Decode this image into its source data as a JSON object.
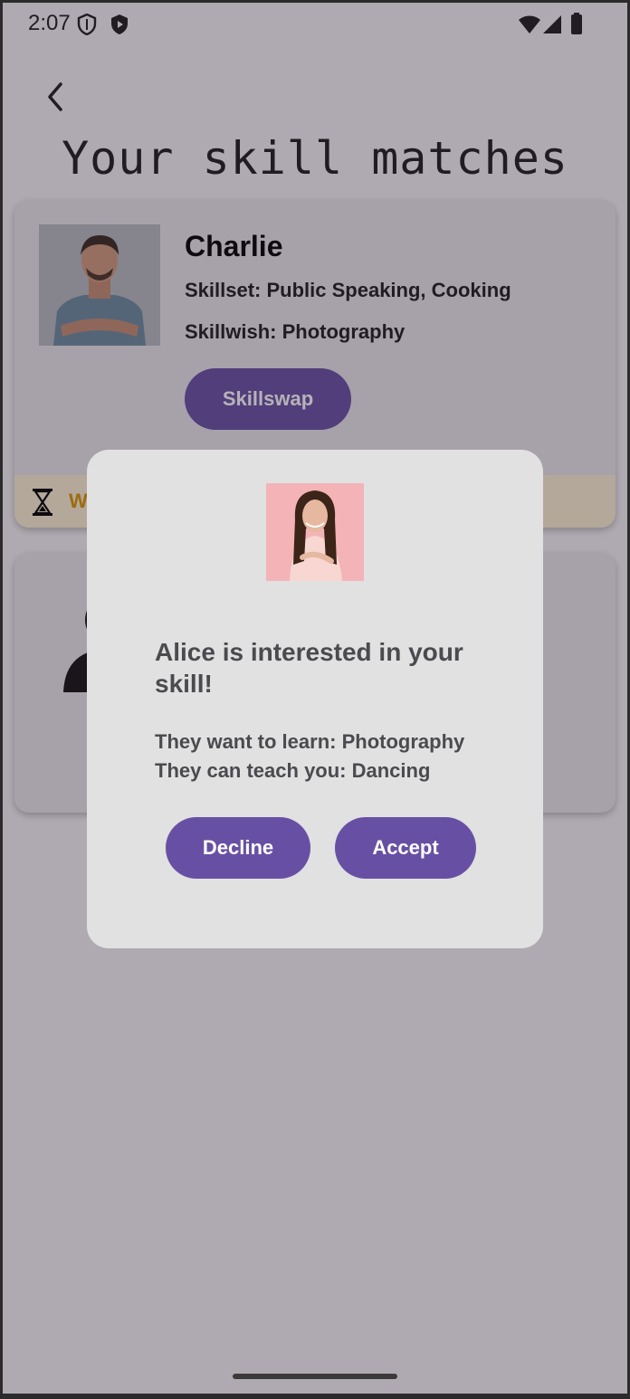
{
  "status_bar": {
    "time": "2:07",
    "left_icons": [
      "shield-icon",
      "play-protect-icon"
    ],
    "right_icons": [
      "wifi-icon",
      "signal-icon",
      "battery-icon"
    ]
  },
  "header": {
    "back_icon": "chevron-left-icon",
    "title": "Your skill matches"
  },
  "match_card": {
    "name": "Charlie",
    "skillset": "Skillset: Public Speaking, Cooking",
    "skillwish": "Skillwish: Photography",
    "button_label": "Skillswap",
    "status_icon": "hourglass-icon",
    "status_text": "W"
  },
  "second_card": {
    "avatar_icon": "person-icon"
  },
  "dialog": {
    "title": "Alice is interested in your skill!",
    "want_line": "They want to learn: Photography",
    "teach_line": "They can teach you: Dancing",
    "decline_label": "Decline",
    "accept_label": "Accept"
  },
  "colors": {
    "accent": "#6750a4",
    "background": "#f5f3f6",
    "card": "#e9e7ec",
    "dialog": "#e1e1e1",
    "waiting_text": "#d99400"
  }
}
